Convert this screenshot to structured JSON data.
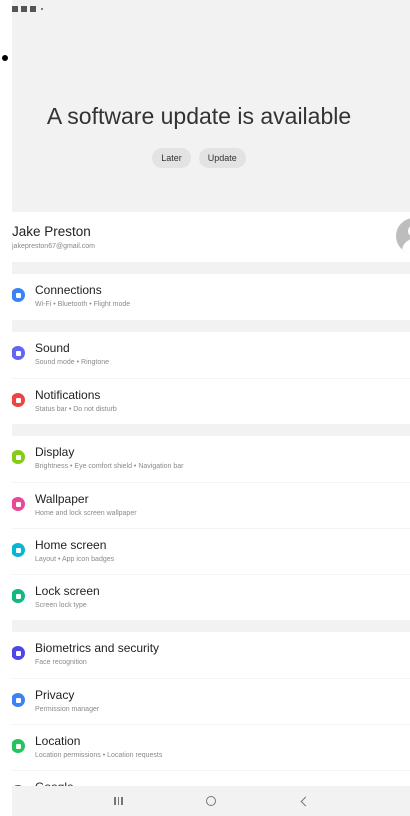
{
  "update": {
    "title": "A software update is available",
    "later_label": "Later",
    "update_label": "Update"
  },
  "profile": {
    "name": "Jake Preston",
    "email": "jakepreston67@gmail.com"
  },
  "settings": [
    {
      "title": "Connections",
      "subtitle": "Wi-Fi • Bluetooth • Flight mode",
      "icon": "wifi-icon",
      "color": "#3b82f6"
    },
    {
      "title": "Sound",
      "subtitle": "Sound mode • Ringtone",
      "icon": "speaker-icon",
      "color": "#6366f1"
    },
    {
      "title": "Notifications",
      "subtitle": "Status bar • Do not disturb",
      "icon": "bell-icon",
      "color": "#ef4444"
    },
    {
      "title": "Display",
      "subtitle": "Brightness • Eye comfort shield • Navigation bar",
      "icon": "sun-icon",
      "color": "#84cc16"
    },
    {
      "title": "Wallpaper",
      "subtitle": "Home and lock screen wallpaper",
      "icon": "image-icon",
      "color": "#ec4899"
    },
    {
      "title": "Home screen",
      "subtitle": "Layout • App icon badges",
      "icon": "home-icon",
      "color": "#06b6d4"
    },
    {
      "title": "Lock screen",
      "subtitle": "Screen lock type",
      "icon": "lock-icon",
      "color": "#10b981"
    },
    {
      "title": "Biometrics and security",
      "subtitle": "Face recognition",
      "icon": "shield-icon",
      "color": "#4f46e5"
    },
    {
      "title": "Privacy",
      "subtitle": "Permission manager",
      "icon": "privacy-icon",
      "color": "#3b82f6"
    },
    {
      "title": "Location",
      "subtitle": "Location permissions • Location requests",
      "icon": "location-icon",
      "color": "#22c55e"
    },
    {
      "title": "Google",
      "subtitle": "",
      "icon": "google-icon",
      "color": "#2563eb"
    }
  ]
}
